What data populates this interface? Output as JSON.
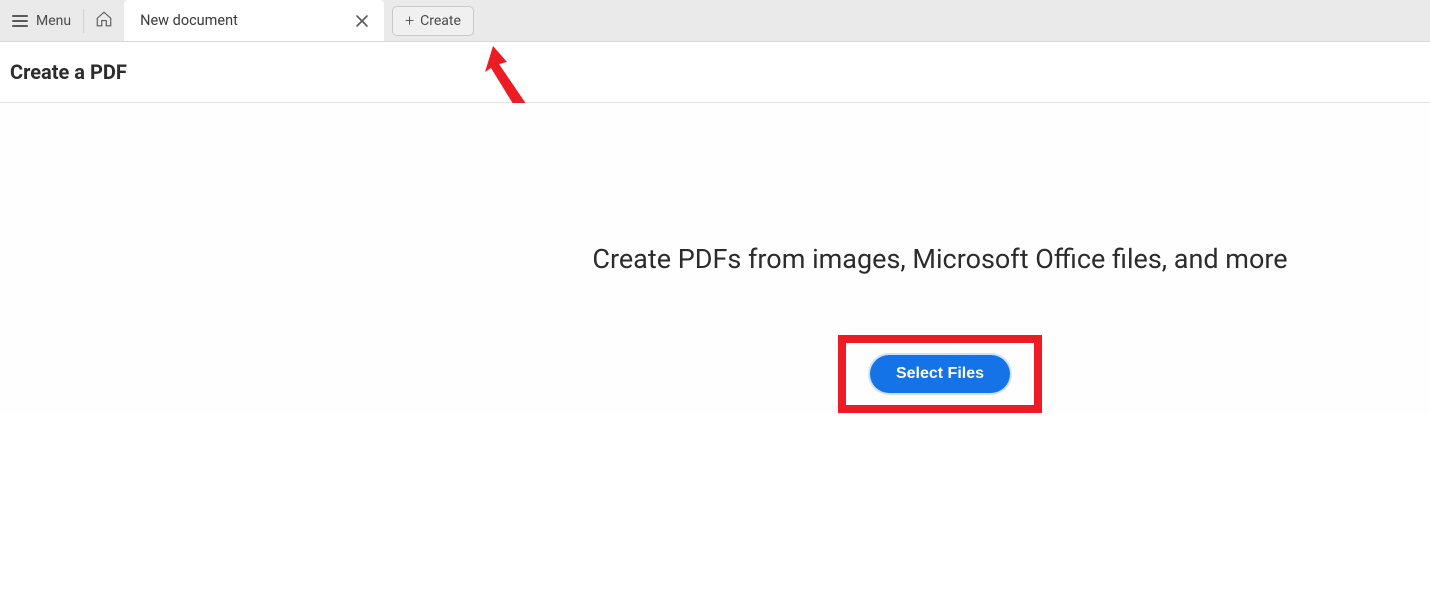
{
  "topbar": {
    "menu_label": "Menu",
    "tab_title": "New document",
    "create_label": "Create"
  },
  "subheader": {
    "title": "Create a PDF"
  },
  "content": {
    "headline": "Create PDFs from images, Microsoft Office files, and more",
    "select_files_label": "Select Files"
  }
}
